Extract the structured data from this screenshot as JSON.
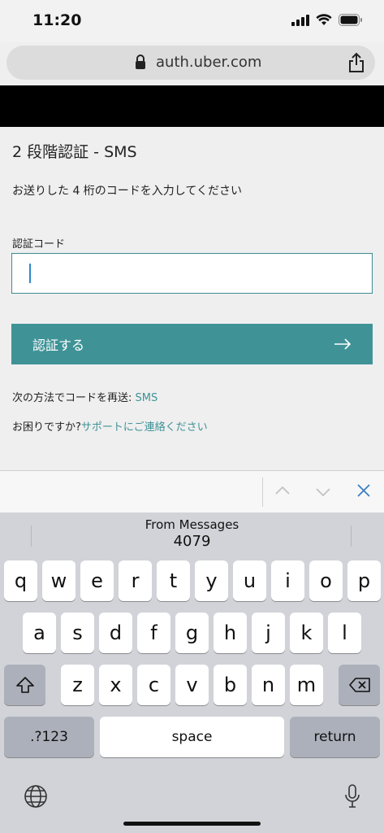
{
  "status_bar": {
    "time": "11:20"
  },
  "browser": {
    "url": "auth.uber.com"
  },
  "page": {
    "title": "2 段階認証 - SMS",
    "instruction": "お送りした 4 桁のコードを入力してください",
    "code_label": "認証コード",
    "code_value": "",
    "verify_button_label": "認証する",
    "resend_prefix": "次の方法でコードを再送: ",
    "resend_link": "SMS",
    "support_prefix": "お困りですか?",
    "support_link": "サポートにご連絡ください"
  },
  "keyboard": {
    "suggestion_source": "From Messages",
    "suggestion_code": "4079",
    "row1": [
      "q",
      "w",
      "e",
      "r",
      "t",
      "y",
      "u",
      "i",
      "o",
      "p"
    ],
    "row2": [
      "a",
      "s",
      "d",
      "f",
      "g",
      "h",
      "j",
      "k",
      "l"
    ],
    "row3": [
      "z",
      "x",
      "c",
      "v",
      "b",
      "n",
      "m"
    ],
    "numbers_label": ".?123",
    "space_label": "space",
    "return_label": "return"
  },
  "colors": {
    "accent": "#3f9397"
  }
}
